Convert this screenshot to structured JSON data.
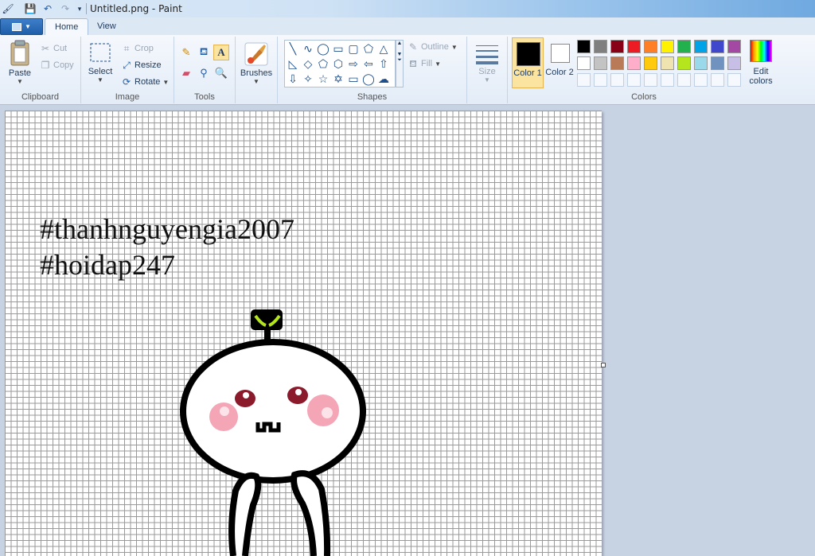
{
  "window": {
    "title": "Untitled.png - Paint"
  },
  "tabs": [
    {
      "label": "Home"
    },
    {
      "label": "View"
    }
  ],
  "clipboard": {
    "paste": "Paste",
    "cut": "Cut",
    "copy": "Copy",
    "label": "Clipboard"
  },
  "image": {
    "select": "Select",
    "crop": "Crop",
    "resize": "Resize",
    "rotate": "Rotate",
    "label": "Image"
  },
  "tools": {
    "label": "Tools"
  },
  "brushes": {
    "label": "Brushes"
  },
  "shapes": {
    "outline": "Outline",
    "fill": "Fill",
    "label": "Shapes"
  },
  "size": {
    "label": "Size"
  },
  "colors": {
    "color1": "Color 1",
    "color2": "Color 2",
    "edit": "Edit colors",
    "label": "Colors",
    "row1": [
      "#000000",
      "#7f7f7f",
      "#880015",
      "#ed1c24",
      "#ff7f27",
      "#fff200",
      "#22b14c",
      "#00a2e8",
      "#3f48cc",
      "#a349a4"
    ],
    "row2": [
      "#ffffff",
      "#c3c3c3",
      "#b97a57",
      "#ffaec9",
      "#ffc90e",
      "#efe4b0",
      "#b5e61d",
      "#99d9ea",
      "#7092be",
      "#c8bfe7"
    ]
  },
  "canvas": {
    "line1": "#thanhnguyengia2007",
    "line2": "#hoidap247"
  }
}
